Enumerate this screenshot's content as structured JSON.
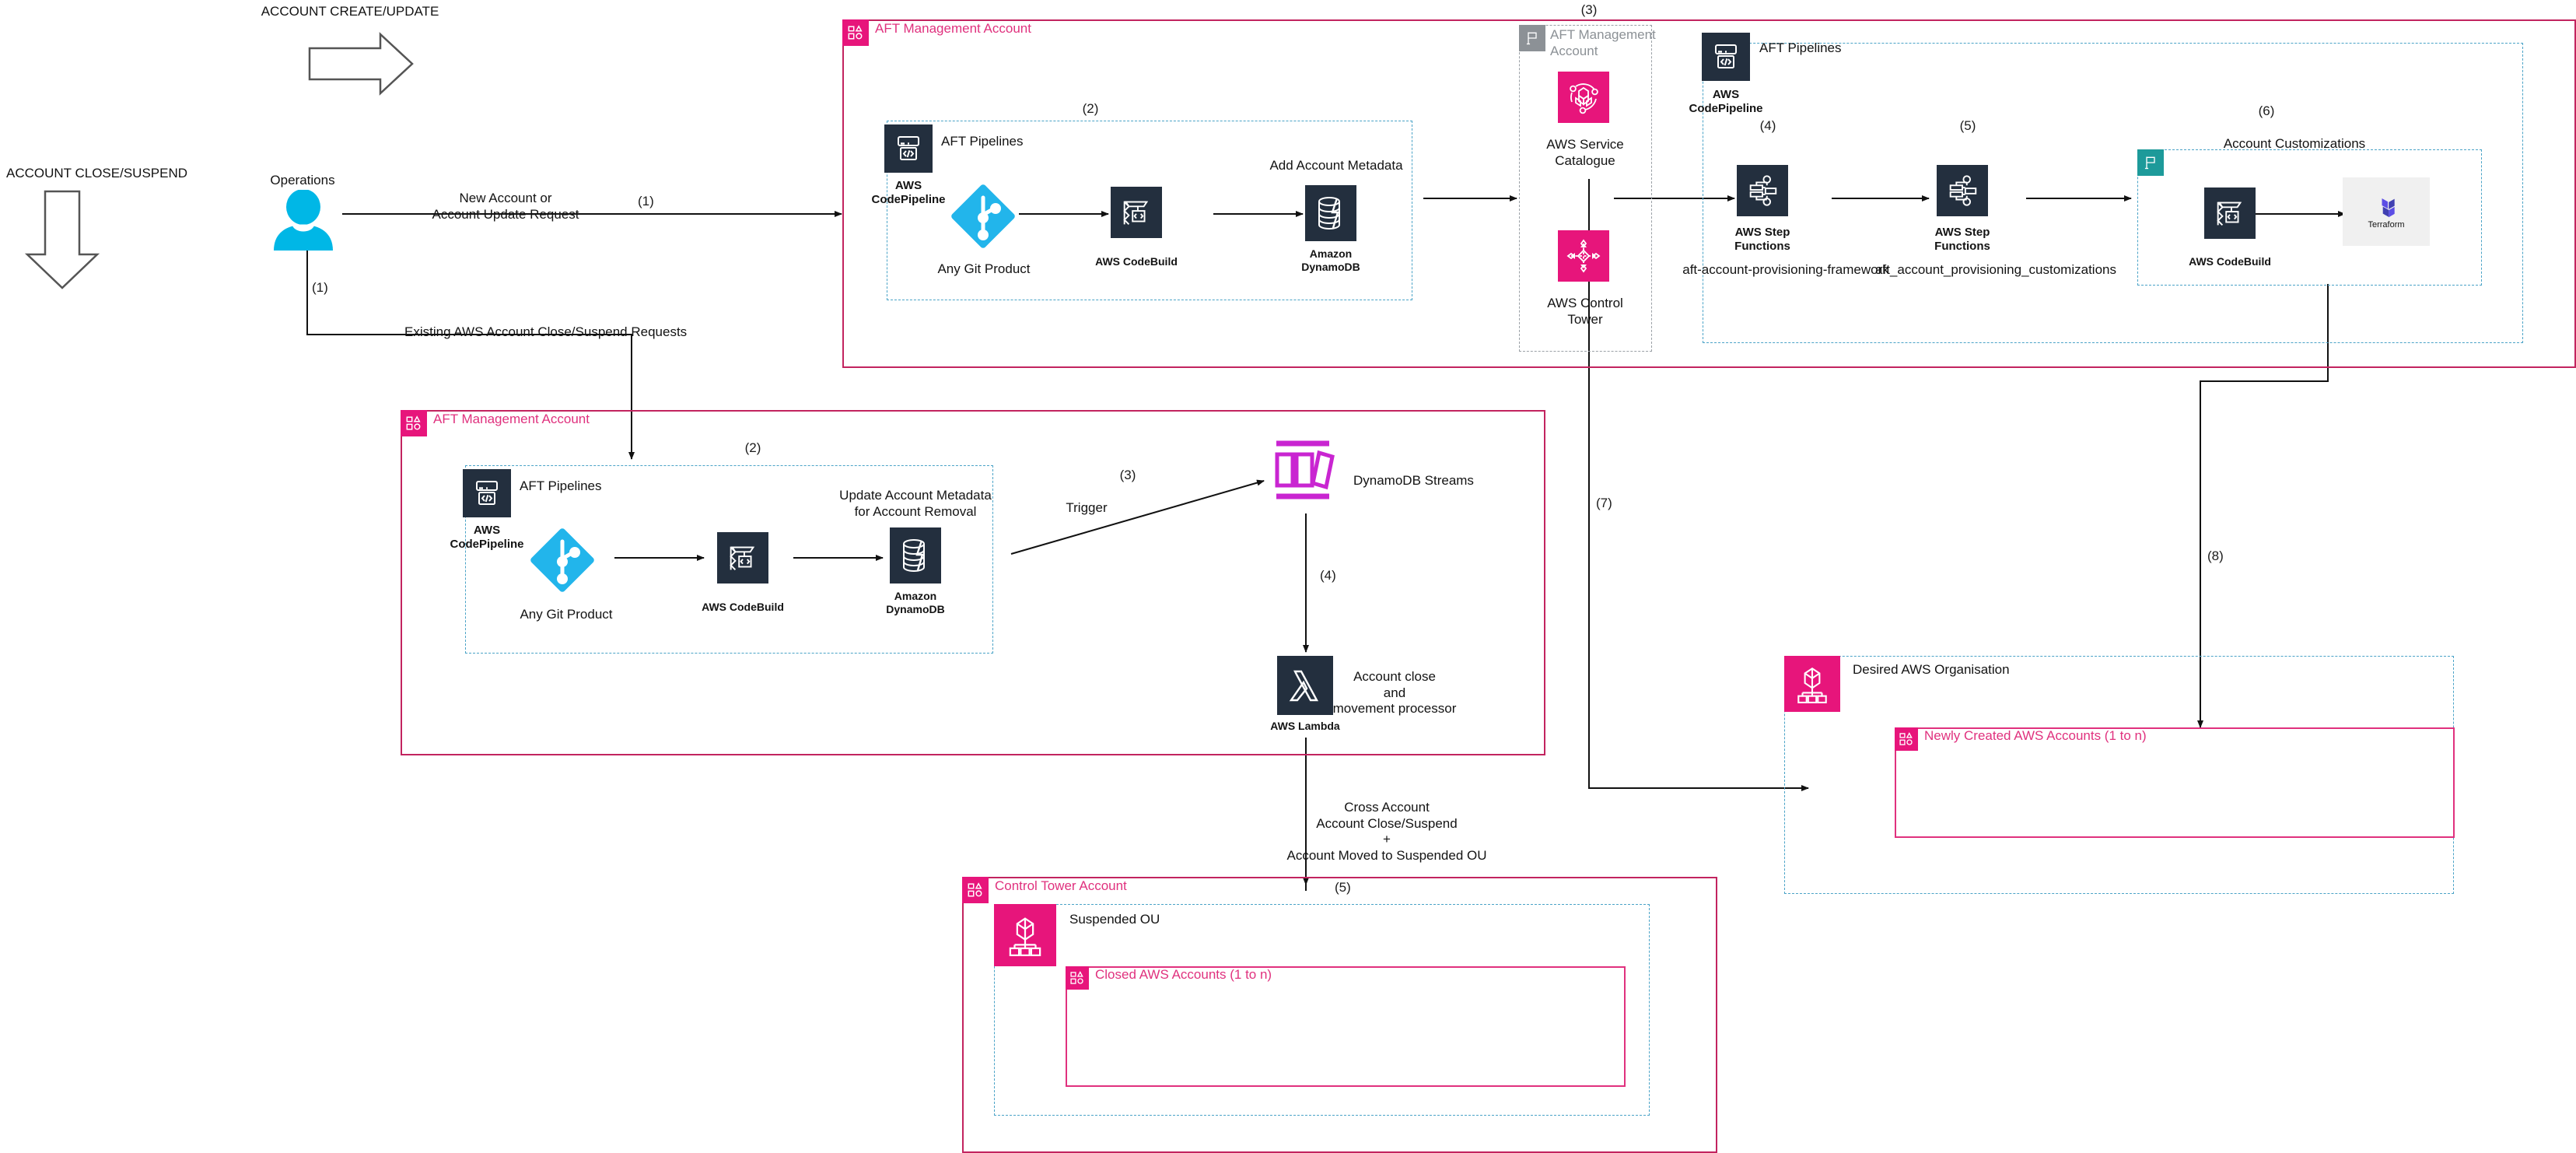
{
  "flows": {
    "create_update_label": "ACCOUNT CREATE/UPDATE",
    "close_suspend_label": "ACCOUNT CLOSE/SUSPEND"
  },
  "actor": {
    "label": "Operations",
    "icon": "person-icon"
  },
  "edges": {
    "new_account_request": "New Account or\nAccount Update Request",
    "new_account_step": "(1)",
    "ops_down_step": "(1)",
    "existing_close_requests": "Existing AWS Account Close/Suspend Requests",
    "trigger": "Trigger",
    "trigger_step": "(3)",
    "stream_to_lambda_step": "(4)",
    "cross_account": "Cross Account\nAccount Close/Suspend\n+\nAccount Moved to Suspended OU",
    "cross_account_step": "(5)",
    "sc_step": "(3)",
    "sf1_step": "(4)",
    "sf2_step": "(5)",
    "cust_step": "(6)",
    "lambda_to_org_step": "(7)",
    "cust_to_newacct_step": "(8)"
  },
  "top_account": {
    "title": "AFT Management Account",
    "tag_icon": "aws-account-icon",
    "pipeline_group": {
      "step": "(2)",
      "title": "AFT Pipelines",
      "codepipeline_label": "AWS\nCodePipeline",
      "nodes": [
        {
          "name": "Any Git Product",
          "icon": "git-icon"
        },
        {
          "name": "AWS CodeBuild",
          "icon": "codebuild-icon"
        },
        {
          "name": "Amazon\nDynamoDB",
          "icon": "dynamodb-icon",
          "caption": "Add Account Metadata"
        }
      ]
    },
    "inner_account": {
      "title": "AFT Management\nAccount",
      "tag_icon": "flag-icon",
      "nodes": [
        {
          "name": "AWS Service\nCatalogue",
          "icon": "service-catalogue-icon"
        },
        {
          "name": "AWS Control\nTower",
          "icon": "control-tower-icon"
        }
      ]
    },
    "provisioning_group": {
      "title": "AFT Pipelines",
      "codepipeline_label": "AWS\nCodePipeline",
      "nodes": [
        {
          "name": "AWS Step\nFunctions",
          "icon": "step-functions-icon",
          "caption": "aft-account-provisioning-framework"
        },
        {
          "name": "AWS Step\nFunctions",
          "icon": "step-functions-icon",
          "caption": "aft_account_provisioning_customizations"
        }
      ],
      "customizations": {
        "title": "Account Customizations",
        "tag_icon": "flag-icon",
        "nodes": [
          {
            "name": "AWS CodeBuild",
            "icon": "codebuild-icon"
          },
          {
            "name": "Terraform",
            "icon": "terraform-icon"
          }
        ]
      }
    }
  },
  "mid_account": {
    "title": "AFT Management Account",
    "tag_icon": "aws-account-icon",
    "pipeline_group": {
      "step": "(2)",
      "title": "AFT Pipelines",
      "codepipeline_label": "AWS\nCodePipeline",
      "nodes": [
        {
          "name": "Any Git Product",
          "icon": "git-icon"
        },
        {
          "name": "AWS CodeBuild",
          "icon": "codebuild-icon"
        },
        {
          "name": "Amazon\nDynamoDB",
          "icon": "dynamodb-icon",
          "caption": "Update Account Metadata\nfor Account Removal"
        }
      ]
    },
    "streams": {
      "name": "DynamoDB Streams",
      "icon": "dynamodb-streams-icon"
    },
    "lambda": {
      "name": "AWS Lambda",
      "icon": "lambda-icon",
      "caption": "Account close\nand\nmovement processor"
    }
  },
  "org_box": {
    "title": "Desired AWS Organisation",
    "tag_icon": "organizations-icon",
    "inner": {
      "title": "Newly Created AWS Accounts (1 to n)",
      "tag_icon": "aws-account-icon"
    }
  },
  "control_tower_account": {
    "title": "Control Tower Account",
    "tag_icon": "aws-account-icon",
    "suspended_ou": {
      "title": "Suspended OU",
      "tag_icon": "organizations-icon",
      "inner": {
        "title": "Closed AWS Accounts (1 to n)",
        "tag_icon": "aws-account-icon"
      }
    }
  },
  "colors": {
    "aws_pink": "#e7157b",
    "account_border": "#c2245f",
    "dash_blue": "#4aa3c7",
    "dash_grey": "#9aa0a6",
    "tile_navy": "#232f3e",
    "git_blue": "#22b5eb",
    "person_blue": "#00b7e6",
    "streams_purple": "#c925d1",
    "terraform_purple": "#5c4ee5",
    "teal": "#1d9a9a"
  }
}
